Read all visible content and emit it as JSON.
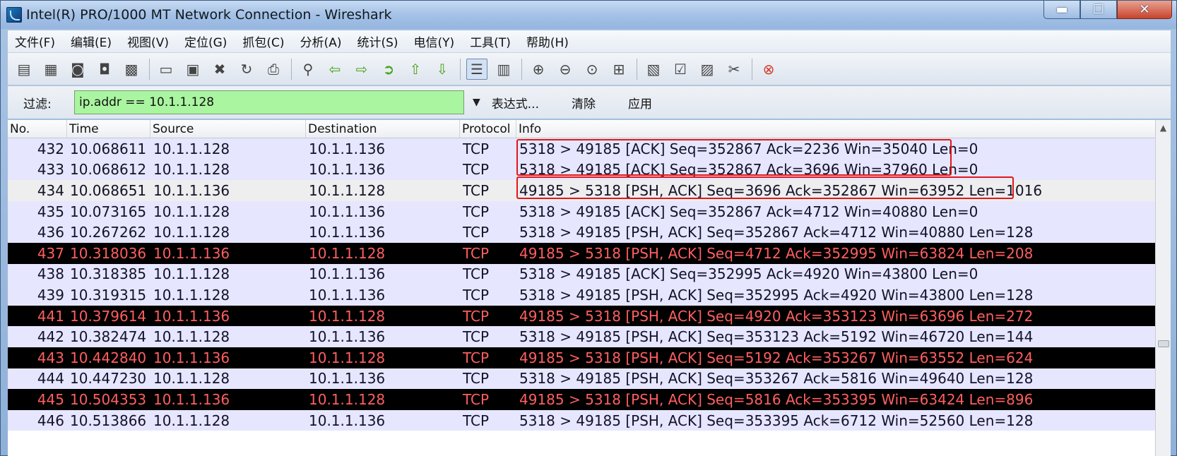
{
  "window": {
    "title": "Intel(R) PRO/1000 MT Network Connection - Wireshark",
    "minimize": "▬",
    "maximize": "☐",
    "close": "✕"
  },
  "menu": [
    "文件(F)",
    "编辑(E)",
    "视图(V)",
    "定位(G)",
    "抓包(C)",
    "分析(A)",
    "统计(S)",
    "电信(Y)",
    "工具(T)",
    "帮助(H)"
  ],
  "filter": {
    "label": "过滤:",
    "value": "ip.addr == 10.1.1.128",
    "expression": "表达式...",
    "clear": "清除",
    "apply": "应用",
    "input_color": "#a9f5a0"
  },
  "columns": [
    "No.",
    "Time",
    "Source",
    "Destination",
    "Protocol",
    "Info"
  ],
  "packets": [
    {
      "no": "432",
      "time": "10.068611",
      "src": "10.1.1.128",
      "dst": "10.1.1.136",
      "proto": "TCP",
      "info": "5318 > 49185 [ACK] Seq=352867 Ack=2236 Win=35040 Len=0",
      "style": "normal"
    },
    {
      "no": "433",
      "time": "10.068612",
      "src": "10.1.1.128",
      "dst": "10.1.1.136",
      "proto": "TCP",
      "info": "5318 > 49185 [ACK] Seq=352867 Ack=3696 Win=37960 Len=0",
      "style": "normal"
    },
    {
      "no": "434",
      "time": "10.068651",
      "src": "10.1.1.136",
      "dst": "10.1.1.128",
      "proto": "TCP",
      "info": "49185 > 5318 [PSH, ACK] Seq=3696 Ack=352867 Win=63952 Len=1016",
      "style": "alt"
    },
    {
      "no": "435",
      "time": "10.073165",
      "src": "10.1.1.128",
      "dst": "10.1.1.136",
      "proto": "TCP",
      "info": "5318 > 49185 [ACK] Seq=352867 Ack=4712 Win=40880 Len=0",
      "style": "normal"
    },
    {
      "no": "436",
      "time": "10.267262",
      "src": "10.1.1.128",
      "dst": "10.1.1.136",
      "proto": "TCP",
      "info": "5318 > 49185 [PSH, ACK] Seq=352867 Ack=4712 Win=40880 Len=128",
      "style": "normal"
    },
    {
      "no": "437",
      "time": "10.318036",
      "src": "10.1.1.136",
      "dst": "10.1.1.128",
      "proto": "TCP",
      "info": "49185 > 5318 [PSH, ACK] Seq=4712 Ack=352995 Win=63824 Len=208",
      "style": "dark"
    },
    {
      "no": "438",
      "time": "10.318385",
      "src": "10.1.1.128",
      "dst": "10.1.1.136",
      "proto": "TCP",
      "info": "5318 > 49185 [ACK] Seq=352995 Ack=4920 Win=43800 Len=0",
      "style": "normal"
    },
    {
      "no": "439",
      "time": "10.319315",
      "src": "10.1.1.128",
      "dst": "10.1.1.136",
      "proto": "TCP",
      "info": "5318 > 49185 [PSH, ACK] Seq=352995 Ack=4920 Win=43800 Len=128",
      "style": "normal"
    },
    {
      "no": "441",
      "time": "10.379614",
      "src": "10.1.1.136",
      "dst": "10.1.1.128",
      "proto": "TCP",
      "info": "49185 > 5318 [PSH, ACK] Seq=4920 Ack=353123 Win=63696 Len=272",
      "style": "dark"
    },
    {
      "no": "442",
      "time": "10.382474",
      "src": "10.1.1.128",
      "dst": "10.1.1.136",
      "proto": "TCP",
      "info": "5318 > 49185 [PSH, ACK] Seq=353123 Ack=5192 Win=46720 Len=144",
      "style": "normal"
    },
    {
      "no": "443",
      "time": "10.442840",
      "src": "10.1.1.136",
      "dst": "10.1.1.128",
      "proto": "TCP",
      "info": "49185 > 5318 [PSH, ACK] Seq=5192 Ack=353267 Win=63552 Len=624",
      "style": "dark"
    },
    {
      "no": "444",
      "time": "10.447230",
      "src": "10.1.1.128",
      "dst": "10.1.1.136",
      "proto": "TCP",
      "info": "5318 > 49185 [PSH, ACK] Seq=353267 Ack=5816 Win=49640 Len=128",
      "style": "normal"
    },
    {
      "no": "445",
      "time": "10.504353",
      "src": "10.1.1.136",
      "dst": "10.1.1.128",
      "proto": "TCP",
      "info": "49185 > 5318 [PSH, ACK] Seq=5816 Ack=353395 Win=63424 Len=896",
      "style": "dark"
    },
    {
      "no": "446",
      "time": "10.513866",
      "src": "10.1.1.128",
      "dst": "10.1.1.136",
      "proto": "TCP",
      "info": "5318 > 49185 [PSH, ACK] Seq=353395 Ack=6712 Win=52560 Len=128",
      "style": "normal"
    }
  ],
  "colors": {
    "normal_row": "#e7e6ff",
    "dark_row": "#000000",
    "dark_row_text": "#ff5f5f",
    "highlight_box": "#e01818"
  },
  "toolbar_icons": [
    "interface-list-icon",
    "capture-options-icon",
    "start-capture-icon",
    "stop-capture-icon",
    "restart-capture-icon",
    "open-file-icon",
    "save-file-icon",
    "close-file-icon",
    "reload-icon",
    "print-icon",
    "find-packet-icon",
    "go-back-icon",
    "go-forward-icon",
    "go-to-packet-icon",
    "go-first-icon",
    "go-last-icon",
    "colorize-icon",
    "autoscroll-icon",
    "zoom-in-icon",
    "zoom-out-icon",
    "normal-size-icon",
    "resize-columns-icon",
    "capture-filters-icon",
    "display-filters-icon",
    "coloring-rules-icon",
    "preferences-icon",
    "help-icon"
  ]
}
